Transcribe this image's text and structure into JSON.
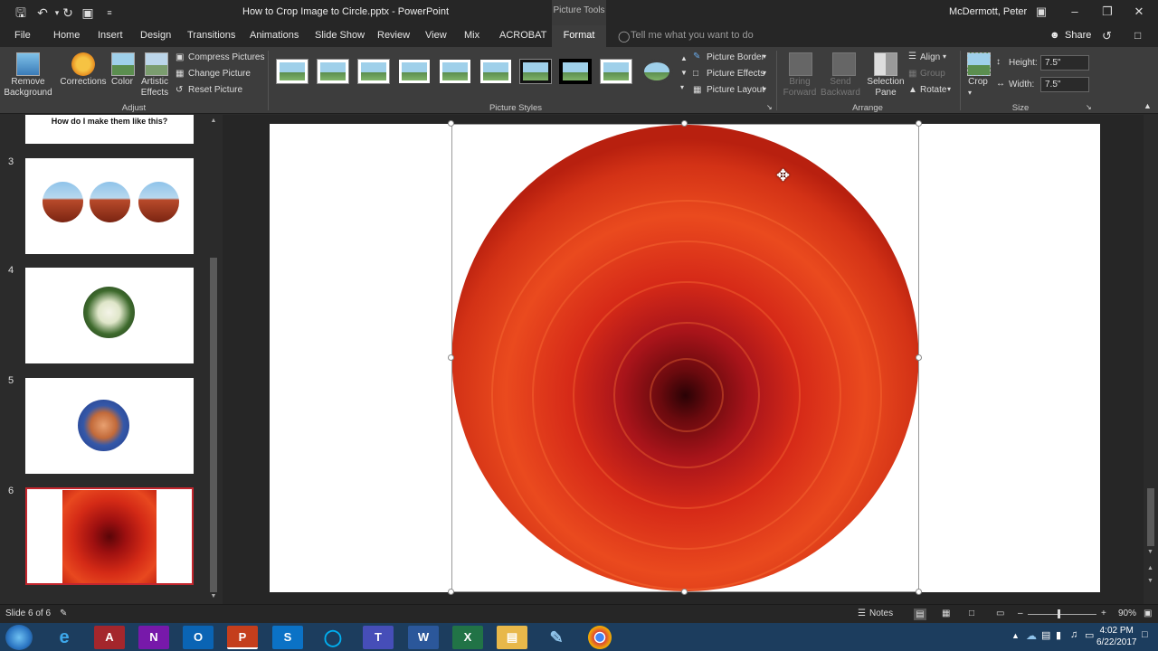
{
  "titlebar": {
    "doc_title": "How to Crop Image to Circle.pptx  -  PowerPoint",
    "contextual_group": "Picture Tools",
    "user": "McDermott, Peter"
  },
  "tabs": [
    "File",
    "Home",
    "Insert",
    "Design",
    "Transitions",
    "Animations",
    "Slide Show",
    "Review",
    "View",
    "Mix",
    "ACROBAT"
  ],
  "active_tab": "Format",
  "tell_me": "Tell me what you want to do",
  "share": "Share",
  "ribbon": {
    "remove_background": "Remove Background",
    "corrections": "Corrections",
    "color": "Color",
    "artistic_effects": "Artistic Effects",
    "compress_pictures": "Compress Pictures",
    "change_picture": "Change Picture",
    "reset_picture": "Reset Picture",
    "adjust_group": "Adjust",
    "picture_border": "Picture Border",
    "picture_effects": "Picture Effects",
    "picture_layout": "Picture Layout",
    "picture_styles_group": "Picture Styles",
    "bring_forward": "Bring Forward",
    "send_backward": "Send Backward",
    "selection_pane": "Selection Pane",
    "align": "Align",
    "group": "Group",
    "rotate": "Rotate",
    "arrange_group": "Arrange",
    "crop": "Crop",
    "height_label": "Height:",
    "height_value": "7.5\"",
    "width_label": "Width:",
    "width_value": "7.5\"",
    "size_group": "Size"
  },
  "slides": {
    "slide2_caption": "How do I make them like this?",
    "numbers": [
      "3",
      "4",
      "5",
      "6"
    ]
  },
  "status": {
    "slide_counter": "Slide 6 of 6",
    "notes": "Notes",
    "zoom": "90%"
  },
  "clock": {
    "time": "4:02 PM",
    "date": "6/22/2017"
  }
}
